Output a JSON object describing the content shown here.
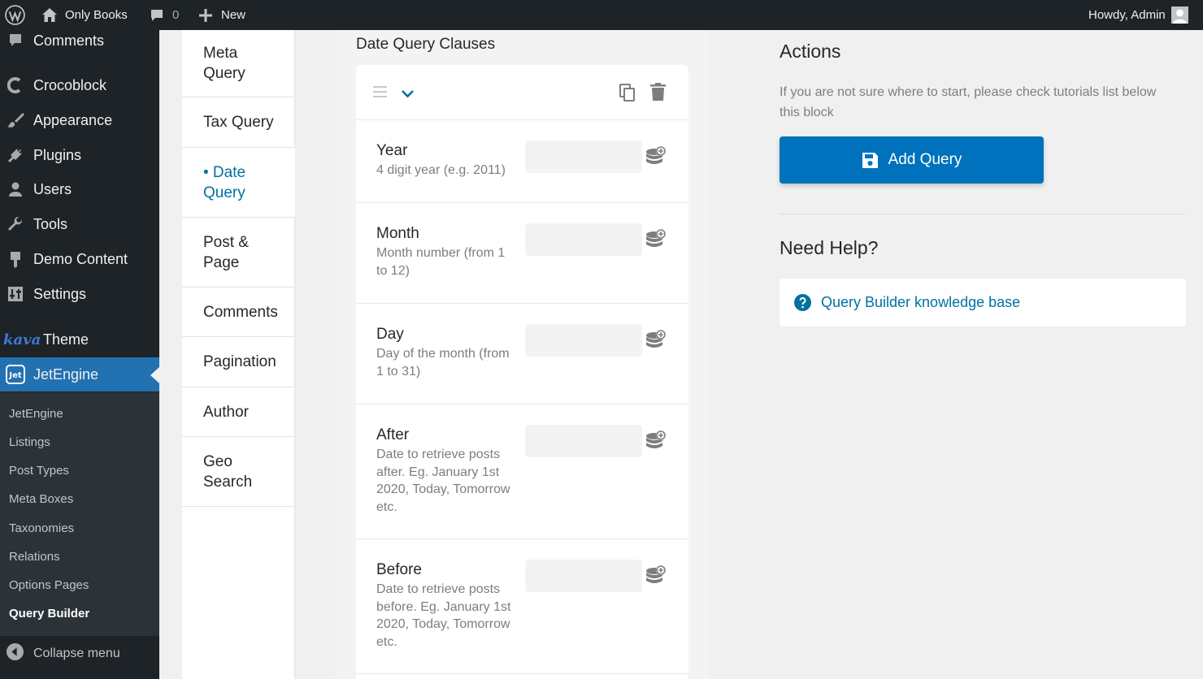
{
  "adminbar": {
    "site_name": "Only Books",
    "comments_count": "0",
    "new_label": "New",
    "greeting": "Howdy, Admin"
  },
  "sidebar": {
    "items": [
      {
        "label": "Comments",
        "icon": "comment-icon"
      },
      {
        "label": "Crocoblock",
        "icon": "crocoblock-icon"
      },
      {
        "label": "Appearance",
        "icon": "paintbrush-icon"
      },
      {
        "label": "Plugins",
        "icon": "plug-icon"
      },
      {
        "label": "Users",
        "icon": "user-icon"
      },
      {
        "label": "Tools",
        "icon": "wrench-icon"
      },
      {
        "label": "Demo Content",
        "icon": "download-icon"
      },
      {
        "label": "Settings",
        "icon": "settings-icon"
      },
      {
        "label": "Theme",
        "logo": "kava",
        "icon": "kava-logo"
      },
      {
        "label": "JetEngine",
        "icon": "jet-icon"
      }
    ],
    "submenu": [
      "JetEngine",
      "Listings",
      "Post Types",
      "Meta Boxes",
      "Taxonomies",
      "Relations",
      "Options Pages",
      "Query Builder"
    ],
    "collapse_label": "Collapse menu"
  },
  "tabs": [
    {
      "label": "Meta Query"
    },
    {
      "label": "Tax Query"
    },
    {
      "label": "• Date Query"
    },
    {
      "label": "Post & Page"
    },
    {
      "label": "Comments"
    },
    {
      "label": "Pagination"
    },
    {
      "label": "Author"
    },
    {
      "label": "Geo Search"
    }
  ],
  "main": {
    "clauses_title": "Date Query Clauses",
    "rows": [
      {
        "label": "Year",
        "desc": "4 digit year (e.g. 2011)"
      },
      {
        "label": "Month",
        "desc": "Month number (from 1 to 12)"
      },
      {
        "label": "Day",
        "desc": "Day of the month (from 1 to 31)"
      },
      {
        "label": "After",
        "desc": "Date to retrieve posts after. Eg. January 1st 2020, Today, Tomorrow etc."
      },
      {
        "label": "Before",
        "desc": "Date to retrieve posts before. Eg. January 1st 2020, Today, Tomorrow etc."
      }
    ]
  },
  "right": {
    "actions_title": "Actions",
    "actions_help": "If you are not sure where to start, please check tutorials list below this block",
    "add_query_label": "Add Query",
    "help_title": "Need Help?",
    "help_link": "Query Builder knowledge base"
  },
  "colors": {
    "accent": "#0071bd",
    "admin_dark": "#1d2327",
    "wp_blue": "#2271b1"
  }
}
